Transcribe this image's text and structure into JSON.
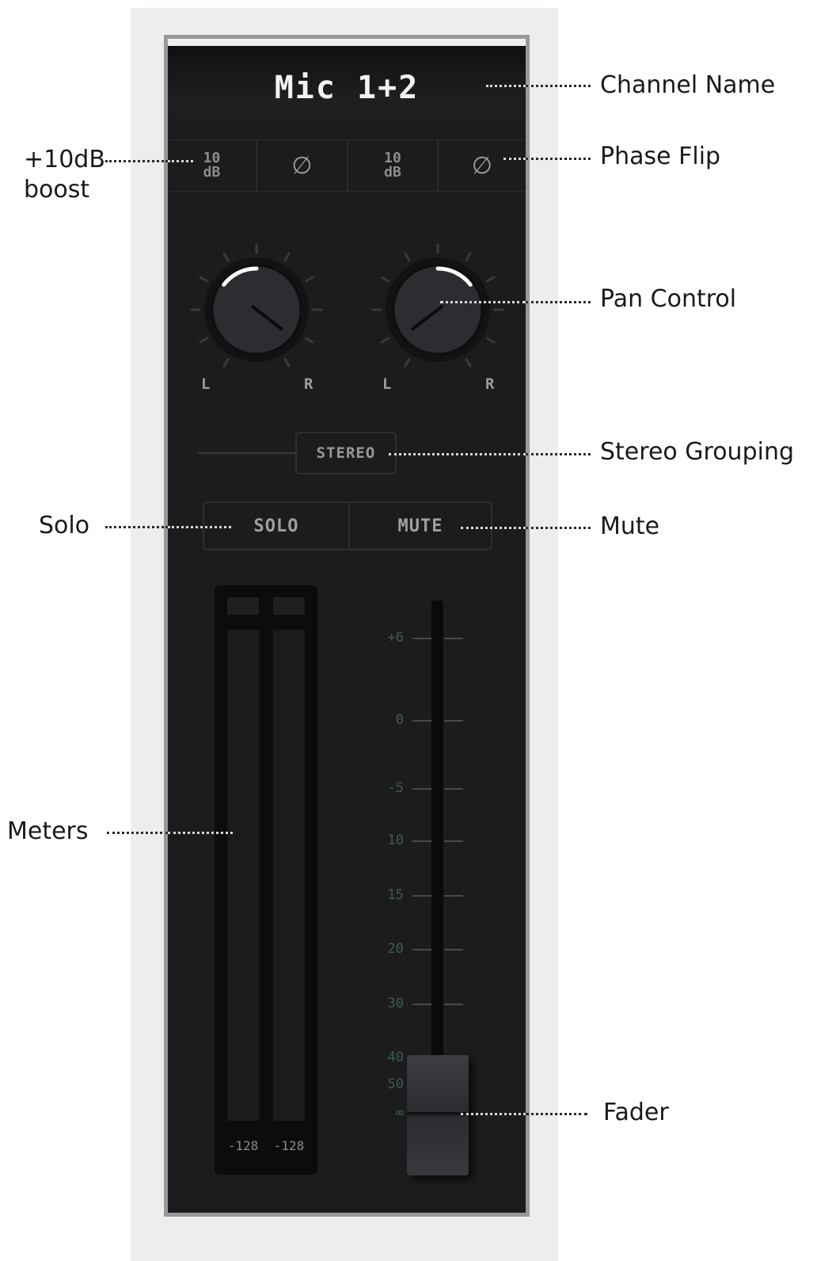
{
  "channel": {
    "name": "Mic 1+2"
  },
  "input_row": {
    "boost_1": {
      "top": "10",
      "bottom": "dB"
    },
    "phase_1": "∅",
    "boost_2": {
      "top": "10",
      "bottom": "dB"
    },
    "phase_2": "∅"
  },
  "pan": {
    "left_knob": {
      "left_label": "L",
      "right_label": "R",
      "value": -0.35
    },
    "right_knob": {
      "left_label": "L",
      "right_label": "R",
      "value": 0.35
    }
  },
  "stereo_button": "STEREO",
  "solo_button": "SOLO",
  "mute_button": "MUTE",
  "meters": {
    "left_readout": "-128",
    "right_readout": "-128"
  },
  "fader": {
    "scale": [
      "+6",
      "0",
      "-5",
      "10",
      "15",
      "20",
      "30",
      "40",
      "50",
      "∞"
    ],
    "value_label": "∞"
  },
  "callouts": {
    "channel_name": "Channel Name",
    "boost": "+10dB\nboost",
    "phase_flip": "Phase Flip",
    "pan_control": "Pan Control",
    "stereo_grouping": "Stereo Grouping",
    "solo": "Solo",
    "mute": "Mute",
    "meters": "Meters",
    "fader": "Fader"
  },
  "colors": {
    "strip_background": "#1c1c1f",
    "knob_arc": "#ffffff",
    "scale_text": "#3f5a55"
  }
}
